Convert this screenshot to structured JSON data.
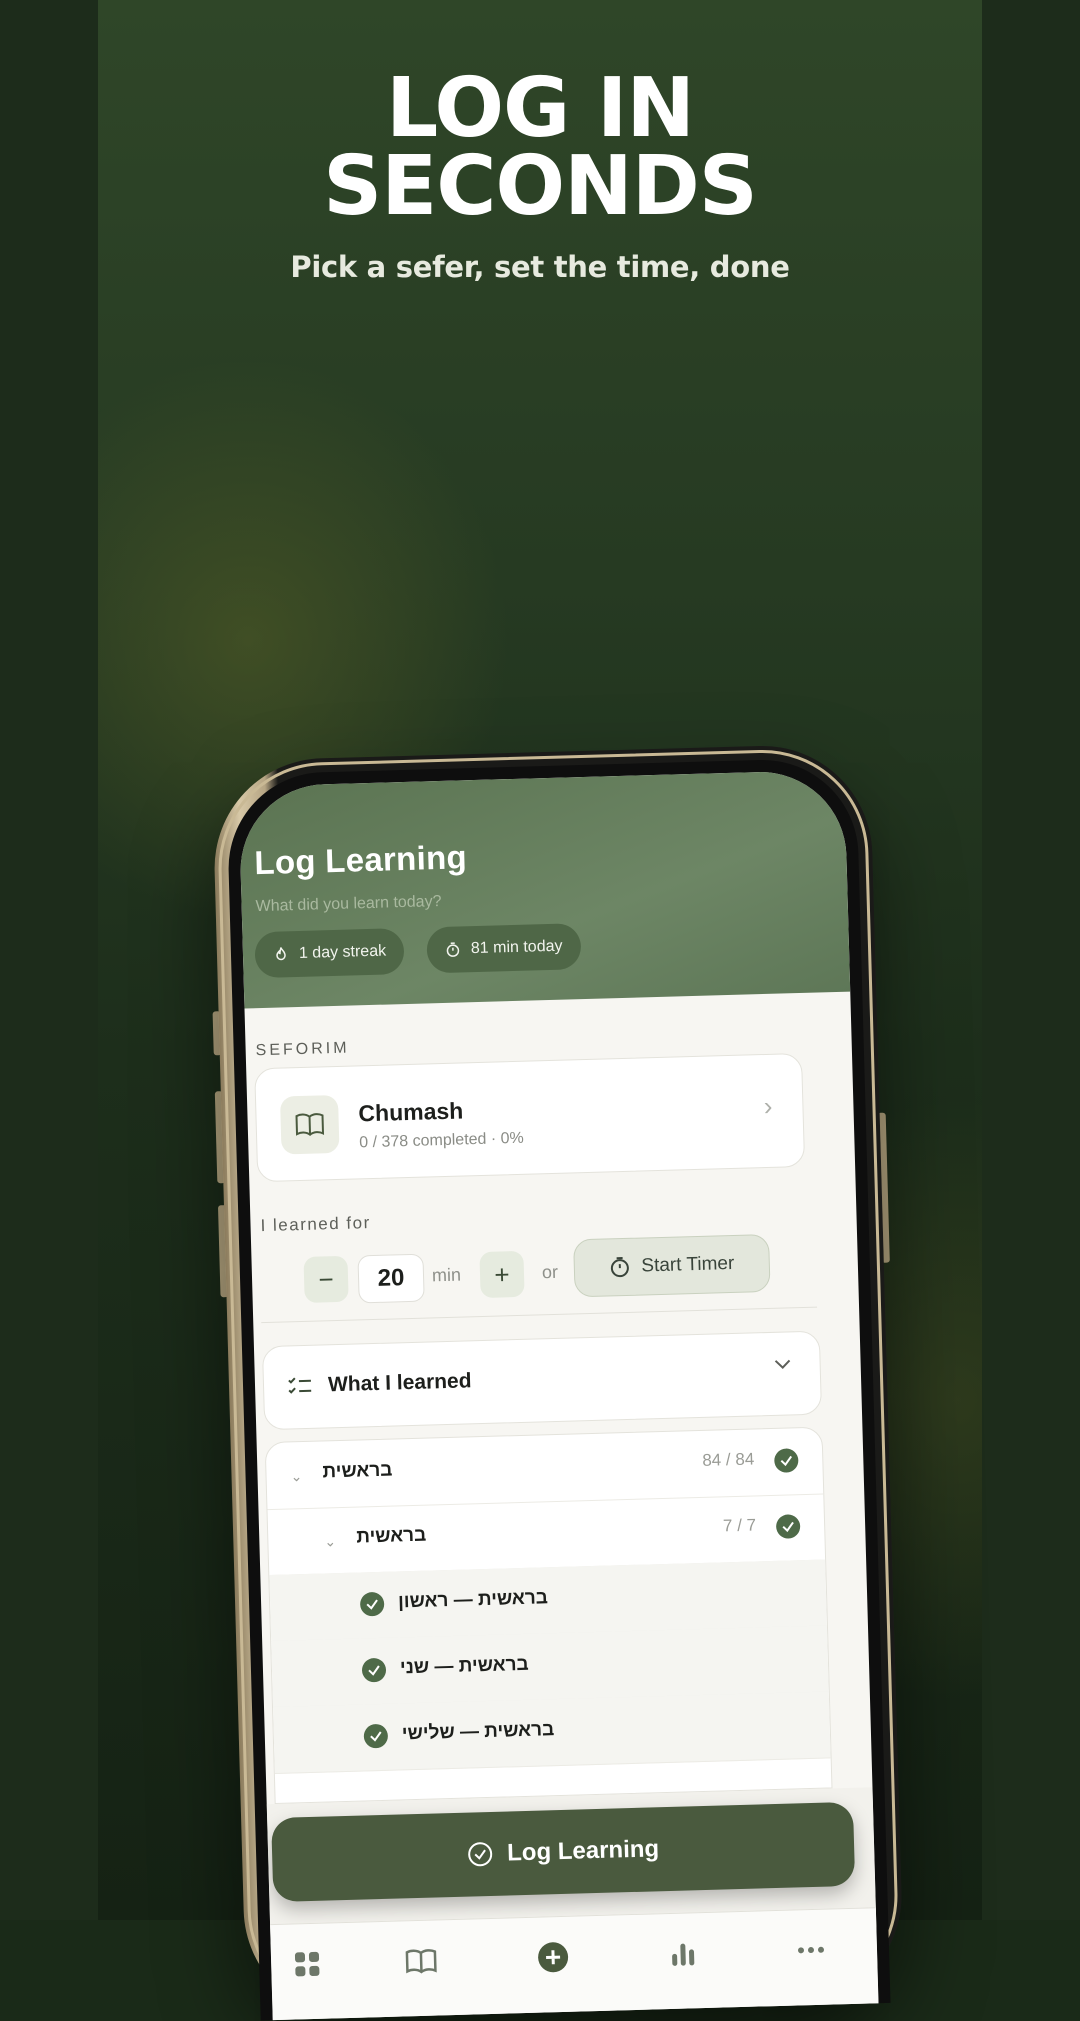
{
  "promo": {
    "headline_line1": "LOG IN",
    "headline_line2": "SECONDS",
    "subheadline": "Pick a sefer, set the time, done"
  },
  "app": {
    "title": "Log Learning",
    "subtitle": "What did you learn today?",
    "streak_chip": "1 day streak",
    "today_chip": "81 min today",
    "seforim_label": "SEFORIM",
    "book": {
      "name": "Chumash",
      "progress": "0 / 378 completed · 0%"
    },
    "learned_for_label": "I learned for",
    "minutes_value": "20",
    "minutes_unit": "min",
    "or_label": "or",
    "start_timer_label": "Start Timer",
    "what_learned_label": "What I learned",
    "tree": [
      {
        "name": "בראשית",
        "count": "84 / 84",
        "checked": true
      },
      {
        "name": "בראשית",
        "count": "7 / 7",
        "checked": true
      },
      {
        "name": "בראשית — ראשון",
        "checked": true
      },
      {
        "name": "בראשית — שני",
        "checked": true
      },
      {
        "name": "בראשית — שלישי",
        "checked": true
      }
    ],
    "cta_label": "Log Learning",
    "tabs": [
      "grid-icon",
      "book-icon",
      "plus-circle-icon",
      "bar-chart-icon",
      "more-icon"
    ]
  },
  "colors": {
    "brand_green": "#4a5a3e",
    "header_green": "#5b7452",
    "check_green": "#4e6a48"
  }
}
